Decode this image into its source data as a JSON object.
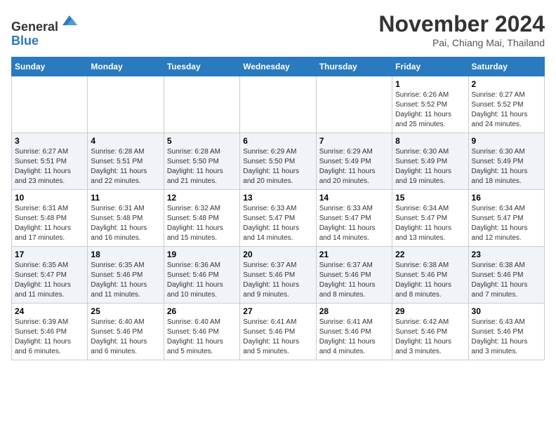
{
  "header": {
    "logo_line1": "General",
    "logo_line2": "Blue",
    "month_title": "November 2024",
    "location": "Pai, Chiang Mai, Thailand"
  },
  "weekdays": [
    "Sunday",
    "Monday",
    "Tuesday",
    "Wednesday",
    "Thursday",
    "Friday",
    "Saturday"
  ],
  "weeks": [
    [
      {
        "day": "",
        "info": ""
      },
      {
        "day": "",
        "info": ""
      },
      {
        "day": "",
        "info": ""
      },
      {
        "day": "",
        "info": ""
      },
      {
        "day": "",
        "info": ""
      },
      {
        "day": "1",
        "info": "Sunrise: 6:26 AM\nSunset: 5:52 PM\nDaylight: 11 hours\nand 25 minutes."
      },
      {
        "day": "2",
        "info": "Sunrise: 6:27 AM\nSunset: 5:52 PM\nDaylight: 11 hours\nand 24 minutes."
      }
    ],
    [
      {
        "day": "3",
        "info": "Sunrise: 6:27 AM\nSunset: 5:51 PM\nDaylight: 11 hours\nand 23 minutes."
      },
      {
        "day": "4",
        "info": "Sunrise: 6:28 AM\nSunset: 5:51 PM\nDaylight: 11 hours\nand 22 minutes."
      },
      {
        "day": "5",
        "info": "Sunrise: 6:28 AM\nSunset: 5:50 PM\nDaylight: 11 hours\nand 21 minutes."
      },
      {
        "day": "6",
        "info": "Sunrise: 6:29 AM\nSunset: 5:50 PM\nDaylight: 11 hours\nand 20 minutes."
      },
      {
        "day": "7",
        "info": "Sunrise: 6:29 AM\nSunset: 5:49 PM\nDaylight: 11 hours\nand 20 minutes."
      },
      {
        "day": "8",
        "info": "Sunrise: 6:30 AM\nSunset: 5:49 PM\nDaylight: 11 hours\nand 19 minutes."
      },
      {
        "day": "9",
        "info": "Sunrise: 6:30 AM\nSunset: 5:49 PM\nDaylight: 11 hours\nand 18 minutes."
      }
    ],
    [
      {
        "day": "10",
        "info": "Sunrise: 6:31 AM\nSunset: 5:48 PM\nDaylight: 11 hours\nand 17 minutes."
      },
      {
        "day": "11",
        "info": "Sunrise: 6:31 AM\nSunset: 5:48 PM\nDaylight: 11 hours\nand 16 minutes."
      },
      {
        "day": "12",
        "info": "Sunrise: 6:32 AM\nSunset: 5:48 PM\nDaylight: 11 hours\nand 15 minutes."
      },
      {
        "day": "13",
        "info": "Sunrise: 6:33 AM\nSunset: 5:47 PM\nDaylight: 11 hours\nand 14 minutes."
      },
      {
        "day": "14",
        "info": "Sunrise: 6:33 AM\nSunset: 5:47 PM\nDaylight: 11 hours\nand 14 minutes."
      },
      {
        "day": "15",
        "info": "Sunrise: 6:34 AM\nSunset: 5:47 PM\nDaylight: 11 hours\nand 13 minutes."
      },
      {
        "day": "16",
        "info": "Sunrise: 6:34 AM\nSunset: 5:47 PM\nDaylight: 11 hours\nand 12 minutes."
      }
    ],
    [
      {
        "day": "17",
        "info": "Sunrise: 6:35 AM\nSunset: 5:47 PM\nDaylight: 11 hours\nand 11 minutes."
      },
      {
        "day": "18",
        "info": "Sunrise: 6:35 AM\nSunset: 5:46 PM\nDaylight: 11 hours\nand 11 minutes."
      },
      {
        "day": "19",
        "info": "Sunrise: 6:36 AM\nSunset: 5:46 PM\nDaylight: 11 hours\nand 10 minutes."
      },
      {
        "day": "20",
        "info": "Sunrise: 6:37 AM\nSunset: 5:46 PM\nDaylight: 11 hours\nand 9 minutes."
      },
      {
        "day": "21",
        "info": "Sunrise: 6:37 AM\nSunset: 5:46 PM\nDaylight: 11 hours\nand 8 minutes."
      },
      {
        "day": "22",
        "info": "Sunrise: 6:38 AM\nSunset: 5:46 PM\nDaylight: 11 hours\nand 8 minutes."
      },
      {
        "day": "23",
        "info": "Sunrise: 6:38 AM\nSunset: 5:46 PM\nDaylight: 11 hours\nand 7 minutes."
      }
    ],
    [
      {
        "day": "24",
        "info": "Sunrise: 6:39 AM\nSunset: 5:46 PM\nDaylight: 11 hours\nand 6 minutes."
      },
      {
        "day": "25",
        "info": "Sunrise: 6:40 AM\nSunset: 5:46 PM\nDaylight: 11 hours\nand 6 minutes."
      },
      {
        "day": "26",
        "info": "Sunrise: 6:40 AM\nSunset: 5:46 PM\nDaylight: 11 hours\nand 5 minutes."
      },
      {
        "day": "27",
        "info": "Sunrise: 6:41 AM\nSunset: 5:46 PM\nDaylight: 11 hours\nand 5 minutes."
      },
      {
        "day": "28",
        "info": "Sunrise: 6:41 AM\nSunset: 5:46 PM\nDaylight: 11 hours\nand 4 minutes."
      },
      {
        "day": "29",
        "info": "Sunrise: 6:42 AM\nSunset: 5:46 PM\nDaylight: 11 hours\nand 3 minutes."
      },
      {
        "day": "30",
        "info": "Sunrise: 6:43 AM\nSunset: 5:46 PM\nDaylight: 11 hours\nand 3 minutes."
      }
    ]
  ]
}
